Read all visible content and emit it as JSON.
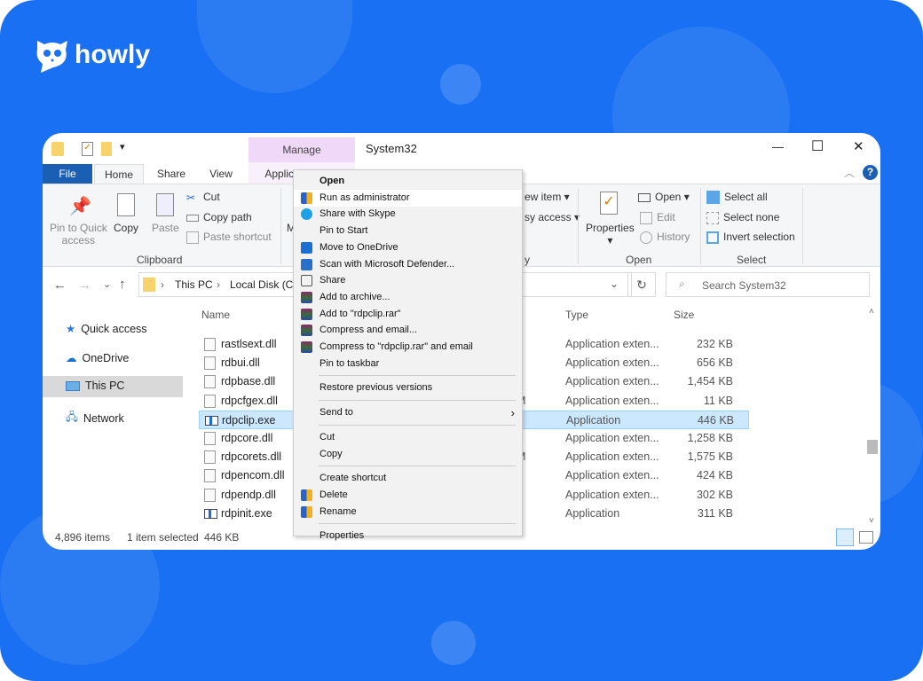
{
  "brand": {
    "name": "howly",
    "bg": "#1a70f2"
  },
  "window": {
    "title": "System32",
    "context_tab": "Manage",
    "tabs": [
      "File",
      "Home",
      "Share",
      "View",
      "Applica"
    ],
    "controls": {
      "minimize": "—",
      "maximize": "☐",
      "close": "✕"
    }
  },
  "ribbon": {
    "clipboard": {
      "pin": "Pin to Quick access",
      "pin1": "Pin to Quick",
      "pin2": "access",
      "copy": "Copy",
      "paste": "Paste",
      "cut": "Cut",
      "copy_path": "Copy path",
      "paste_shortcut": "Paste shortcut",
      "label": "Clipboard"
    },
    "organize": {
      "partial": "M"
    },
    "new": {
      "new_item": "ew item ▾",
      "easy_access": "sy access ▾",
      "label_partial": "y"
    },
    "open": {
      "properties": "Properties",
      "open": "Open ▾",
      "edit": "Edit",
      "history": "History",
      "label": "Open"
    },
    "select": {
      "select_all": "Select all",
      "select_none": "Select none",
      "invert": "Invert selection",
      "label": "Select"
    }
  },
  "address": {
    "crumbs": [
      "This PC",
      "Local Disk (C:"
    ],
    "search_placeholder": "Search System32"
  },
  "nav": [
    "Quick access",
    "OneDrive",
    "This PC",
    "Network"
  ],
  "columns": {
    "name": "Name",
    "type": "Type",
    "size": "Size"
  },
  "files": [
    {
      "name": "rastlsext.dll",
      "type": "Application exten...",
      "size": "232 KB",
      "exe": false,
      "date": ""
    },
    {
      "name": "rdbui.dll",
      "type": "Application exten...",
      "size": "656 KB",
      "exe": false,
      "date": ""
    },
    {
      "name": "rdpbase.dll",
      "type": "Application exten...",
      "size": "1,454 KB",
      "exe": false,
      "date": "I"
    },
    {
      "name": "rdpcfgex.dll",
      "type": "Application exten...",
      "size": "11 KB",
      "exe": false,
      "date": "M"
    },
    {
      "name": "rdpclip.exe",
      "type": "Application",
      "size": "446 KB",
      "exe": true,
      "date": ""
    },
    {
      "name": "rdpcore.dll",
      "type": "Application exten...",
      "size": "1,258 KB",
      "exe": false,
      "date": ""
    },
    {
      "name": "rdpcorets.dll",
      "type": "Application exten...",
      "size": "1,575 KB",
      "exe": false,
      "date": "M"
    },
    {
      "name": "rdpencom.dll",
      "type": "Application exten...",
      "size": "424 KB",
      "exe": false,
      "date": ""
    },
    {
      "name": "rdpendp.dll",
      "type": "Application exten...",
      "size": "302 KB",
      "exe": false,
      "date": ""
    },
    {
      "name": "rdpinit.exe",
      "type": "Application",
      "size": "311 KB",
      "exe": true,
      "date": ""
    }
  ],
  "status": {
    "count": "4,896 items",
    "selected": "1 item selected",
    "size": "446 KB"
  },
  "context_menu": [
    {
      "label": "Open",
      "bold": true
    },
    {
      "label": "Run as administrator",
      "icon": "shield-icon",
      "hover": true
    },
    {
      "label": "Share with Skype",
      "icon": "skype-icon"
    },
    {
      "label": "Pin to Start"
    },
    {
      "label": "Move to OneDrive",
      "icon": "onedrive-icon"
    },
    {
      "label": "Scan with Microsoft Defender...",
      "icon": "defender-icon"
    },
    {
      "label": "Share",
      "icon": "share-icon"
    },
    {
      "label": "Add to archive...",
      "icon": "winrar-icon"
    },
    {
      "label": "Add to \"rdpclip.rar\"",
      "icon": "winrar-icon"
    },
    {
      "label": "Compress and email...",
      "icon": "winrar-icon"
    },
    {
      "label": "Compress to \"rdpclip.rar\" and email",
      "icon": "winrar-icon"
    },
    {
      "label": "Pin to taskbar"
    },
    {
      "sep": true
    },
    {
      "label": "Restore previous versions"
    },
    {
      "sep": true
    },
    {
      "label": "Send to",
      "submenu": true
    },
    {
      "sep": true
    },
    {
      "label": "Cut"
    },
    {
      "label": "Copy"
    },
    {
      "sep": true
    },
    {
      "label": "Create shortcut"
    },
    {
      "label": "Delete",
      "icon": "shield-icon"
    },
    {
      "label": "Rename",
      "icon": "shield-icon"
    },
    {
      "sep": true
    },
    {
      "label": "Properties"
    }
  ]
}
